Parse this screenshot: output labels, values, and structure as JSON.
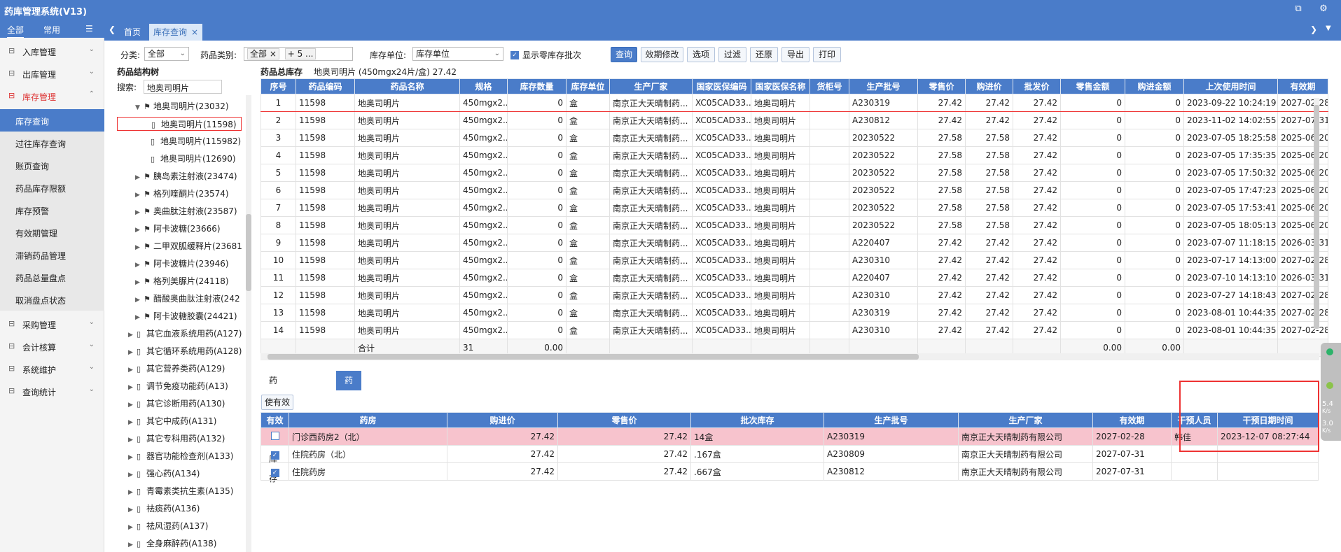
{
  "app": {
    "title": "药库管理系统(V13)"
  },
  "nav": {
    "tab_all": "全部",
    "tab_common": "常用"
  },
  "menu": [
    {
      "label": "入库管理",
      "icon": "inbound-icon"
    },
    {
      "label": "出库管理",
      "icon": "outbound-icon"
    },
    {
      "label": "库存管理",
      "icon": "inventory-icon"
    },
    {
      "label": "采购管理",
      "icon": "purchase-icon"
    },
    {
      "label": "会计核算",
      "icon": "accounting-icon"
    },
    {
      "label": "系统维护",
      "icon": "settings-icon"
    },
    {
      "label": "查询统计",
      "icon": "stats-icon"
    }
  ],
  "submenu": [
    "库存查询",
    "过往库存查询",
    "账页查询",
    "药品库存限额",
    "库存预警",
    "有效期管理",
    "滞销药品管理",
    "药品总量盘点",
    "取消盘点状态"
  ],
  "tabs": {
    "home": "首页",
    "current": "库存查询"
  },
  "filters": {
    "category_label": "分类:",
    "category_value": "全部",
    "drugtype_label": "药品类别:",
    "drugtype_tag1": "全部",
    "drugtype_tag2": "+ 5 ...",
    "unit_label": "库存单位:",
    "unit_value": "库存单位",
    "zero_label": "显示零库存批次"
  },
  "toolbar": [
    "查询",
    "效期修改",
    "选项",
    "过滤",
    "还原",
    "导出",
    "打印"
  ],
  "tree": {
    "header": "药品结构树",
    "search_label": "搜索:",
    "search_value": "地奥司明片",
    "nodes": [
      {
        "label": "地奥司明片(23032)",
        "lvl": 2,
        "type": "flag",
        "tw": "▼"
      },
      {
        "label": "地奥司明片(11598)",
        "lvl": 3,
        "type": "doc",
        "tw": "",
        "hl": true
      },
      {
        "label": "地奥司明片(115982)",
        "lvl": 3,
        "type": "doc",
        "tw": ""
      },
      {
        "label": "地奥司明片(12690)",
        "lvl": 3,
        "type": "doc",
        "tw": ""
      },
      {
        "label": "胰岛素注射液(23474)",
        "lvl": 2,
        "type": "flag",
        "tw": "▶"
      },
      {
        "label": "格列喹酮片(23574)",
        "lvl": 2,
        "type": "flag",
        "tw": "▶"
      },
      {
        "label": "奥曲肽注射液(23587)",
        "lvl": 2,
        "type": "flag",
        "tw": "▶"
      },
      {
        "label": "阿卡波糖(23666)",
        "lvl": 2,
        "type": "flag",
        "tw": "▶"
      },
      {
        "label": "二甲双胍缓释片(23681",
        "lvl": 2,
        "type": "flag",
        "tw": "▶"
      },
      {
        "label": "阿卡波糖片(23946)",
        "lvl": 2,
        "type": "flag",
        "tw": "▶"
      },
      {
        "label": "格列美脲片(24118)",
        "lvl": 2,
        "type": "flag",
        "tw": "▶"
      },
      {
        "label": "醋酸奥曲肽注射液(242",
        "lvl": 2,
        "type": "flag",
        "tw": "▶"
      },
      {
        "label": "阿卡波糖胶囊(24421)",
        "lvl": 2,
        "type": "flag",
        "tw": "▶"
      },
      {
        "label": "其它血液系统用药(A127)",
        "lvl": 1,
        "type": "doc",
        "tw": "▶"
      },
      {
        "label": "其它循环系统用药(A128)",
        "lvl": 1,
        "type": "doc",
        "tw": "▶"
      },
      {
        "label": "其它营养类药(A129)",
        "lvl": 1,
        "type": "doc",
        "tw": "▶"
      },
      {
        "label": "调节免疫功能药(A13)",
        "lvl": 1,
        "type": "doc",
        "tw": "▶"
      },
      {
        "label": "其它诊断用药(A130)",
        "lvl": 1,
        "type": "doc",
        "tw": "▶"
      },
      {
        "label": "其它中成药(A131)",
        "lvl": 1,
        "type": "doc",
        "tw": "▶"
      },
      {
        "label": "其它专科用药(A132)",
        "lvl": 1,
        "type": "doc",
        "tw": "▶"
      },
      {
        "label": "器官功能检查剂(A133)",
        "lvl": 1,
        "type": "doc",
        "tw": "▶"
      },
      {
        "label": "强心药(A134)",
        "lvl": 1,
        "type": "doc",
        "tw": "▶"
      },
      {
        "label": "青霉素类抗生素(A135)",
        "lvl": 1,
        "type": "doc",
        "tw": "▶"
      },
      {
        "label": "祛痰药(A136)",
        "lvl": 1,
        "type": "doc",
        "tw": "▶"
      },
      {
        "label": "祛风湿药(A137)",
        "lvl": 1,
        "type": "doc",
        "tw": "▶"
      },
      {
        "label": "全身麻醉药(A138)",
        "lvl": 1,
        "type": "doc",
        "tw": "▶"
      }
    ]
  },
  "main_grid": {
    "caption": "药品总库存",
    "caption_detail": "地奥司明片 (450mgx24片/盒) 27.42",
    "columns": [
      "序号",
      "药品编码",
      "药品名称",
      "规格",
      "库存数量",
      "库存单位",
      "生产厂家",
      "国家医保编码",
      "国家医保名称",
      "货柜号",
      "生产批号",
      "零售价",
      "购进价",
      "批发价",
      "零售金额",
      "购进金额",
      "上次使用时间",
      "有效期"
    ],
    "rows": [
      [
        "1",
        "11598",
        "地奥司明片",
        "450mgx2...",
        "0",
        "盒",
        "南京正大天晴制药...",
        "XC05CAD33...",
        "地奥司明片",
        "",
        "A230319",
        "27.42",
        "27.42",
        "27.42",
        "0",
        "0",
        "2023-09-22 10:24:19",
        "2027-02-28"
      ],
      [
        "2",
        "11598",
        "地奥司明片",
        "450mgx2...",
        "0",
        "盒",
        "南京正大天晴制药...",
        "XC05CAD33...",
        "地奥司明片",
        "",
        "A230812",
        "27.42",
        "27.42",
        "27.42",
        "0",
        "0",
        "2023-11-02 14:02:55",
        "2027-07-31"
      ],
      [
        "3",
        "11598",
        "地奥司明片",
        "450mgx2...",
        "0",
        "盒",
        "南京正大天晴制药...",
        "XC05CAD33...",
        "地奥司明片",
        "",
        "20230522",
        "27.58",
        "27.58",
        "27.42",
        "0",
        "0",
        "2023-07-05 18:25:58",
        "2025-06-20"
      ],
      [
        "4",
        "11598",
        "地奥司明片",
        "450mgx2...",
        "0",
        "盒",
        "南京正大天晴制药...",
        "XC05CAD33...",
        "地奥司明片",
        "",
        "20230522",
        "27.58",
        "27.58",
        "27.42",
        "0",
        "0",
        "2023-07-05 17:35:35",
        "2025-06-20"
      ],
      [
        "5",
        "11598",
        "地奥司明片",
        "450mgx2...",
        "0",
        "盒",
        "南京正大天晴制药...",
        "XC05CAD33...",
        "地奥司明片",
        "",
        "20230522",
        "27.58",
        "27.58",
        "27.42",
        "0",
        "0",
        "2023-07-05 17:50:32",
        "2025-06-20"
      ],
      [
        "6",
        "11598",
        "地奥司明片",
        "450mgx2...",
        "0",
        "盒",
        "南京正大天晴制药...",
        "XC05CAD33...",
        "地奥司明片",
        "",
        "20230522",
        "27.58",
        "27.58",
        "27.42",
        "0",
        "0",
        "2023-07-05 17:47:23",
        "2025-06-20"
      ],
      [
        "7",
        "11598",
        "地奥司明片",
        "450mgx2...",
        "0",
        "盒",
        "南京正大天晴制药...",
        "XC05CAD33...",
        "地奥司明片",
        "",
        "20230522",
        "27.58",
        "27.58",
        "27.42",
        "0",
        "0",
        "2023-07-05 17:53:41",
        "2025-06-20"
      ],
      [
        "8",
        "11598",
        "地奥司明片",
        "450mgx2...",
        "0",
        "盒",
        "南京正大天晴制药...",
        "XC05CAD33...",
        "地奥司明片",
        "",
        "20230522",
        "27.58",
        "27.58",
        "27.42",
        "0",
        "0",
        "2023-07-05 18:05:13",
        "2025-06-20"
      ],
      [
        "9",
        "11598",
        "地奥司明片",
        "450mgx2...",
        "0",
        "盒",
        "南京正大天晴制药...",
        "XC05CAD33...",
        "地奥司明片",
        "",
        "A220407",
        "27.42",
        "27.42",
        "27.42",
        "0",
        "0",
        "2023-07-07 11:18:15",
        "2026-03-31"
      ],
      [
        "10",
        "11598",
        "地奥司明片",
        "450mgx2...",
        "0",
        "盒",
        "南京正大天晴制药...",
        "XC05CAD33...",
        "地奥司明片",
        "",
        "A230310",
        "27.42",
        "27.42",
        "27.42",
        "0",
        "0",
        "2023-07-17 14:13:00",
        "2027-02-28"
      ],
      [
        "11",
        "11598",
        "地奥司明片",
        "450mgx2...",
        "0",
        "盒",
        "南京正大天晴制药...",
        "XC05CAD33...",
        "地奥司明片",
        "",
        "A220407",
        "27.42",
        "27.42",
        "27.42",
        "0",
        "0",
        "2023-07-10 14:13:10",
        "2026-03-31"
      ],
      [
        "12",
        "11598",
        "地奥司明片",
        "450mgx2...",
        "0",
        "盒",
        "南京正大天晴制药...",
        "XC05CAD33...",
        "地奥司明片",
        "",
        "A230310",
        "27.42",
        "27.42",
        "27.42",
        "0",
        "0",
        "2023-07-27 14:18:43",
        "2027-02-28"
      ],
      [
        "13",
        "11598",
        "地奥司明片",
        "450mgx2...",
        "0",
        "盒",
        "南京正大天晴制药...",
        "XC05CAD33...",
        "地奥司明片",
        "",
        "A230319",
        "27.42",
        "27.42",
        "27.42",
        "0",
        "0",
        "2023-08-01 10:44:35",
        "2027-02-28"
      ],
      [
        "14",
        "11598",
        "地奥司明片",
        "450mgx2...",
        "0",
        "盒",
        "南京正大天晴制药...",
        "XC05CAD33...",
        "地奥司明片",
        "",
        "A230310",
        "27.42",
        "27.42",
        "27.42",
        "0",
        "0",
        "2023-08-01 10:44:35",
        "2027-02-28"
      ]
    ],
    "total_label": "合计",
    "total_qty": "31",
    "total_amount": "0.00",
    "total_retail": "0.00",
    "total_purchase": "0.00"
  },
  "bottom": {
    "tab1": "药品批次库存",
    "tab2": "药房批次库存",
    "enable_button": "使有效",
    "columns": [
      "有效",
      "药房",
      "购进价",
      "零售价",
      "批次库存",
      "生产批号",
      "生产厂家",
      "有效期",
      "干预人员",
      "干预日期时间"
    ],
    "rows": [
      {
        "checked": false,
        "cells": [
          "门诊西药房2（北）",
          "27.42",
          "27.42",
          "14盒",
          "A230319",
          "南京正大天晴制药有限公司",
          "2027-02-28",
          "韩佳",
          "2023-12-07 08:27:44"
        ]
      },
      {
        "checked": true,
        "cells": [
          "住院药房（北）",
          "27.42",
          "27.42",
          ".167盒",
          "A230809",
          "南京正大天晴制药有限公司",
          "2027-07-31",
          "",
          ""
        ]
      },
      {
        "checked": true,
        "cells": [
          "住院药房",
          "27.42",
          "27.42",
          ".667盒",
          "A230812",
          "南京正大天晴制药有限公司",
          "2027-07-31",
          "",
          ""
        ]
      }
    ]
  },
  "widget": {
    "v1": "5.4",
    "u1": "K/s",
    "v2": "3.0",
    "u2": "K/s"
  }
}
